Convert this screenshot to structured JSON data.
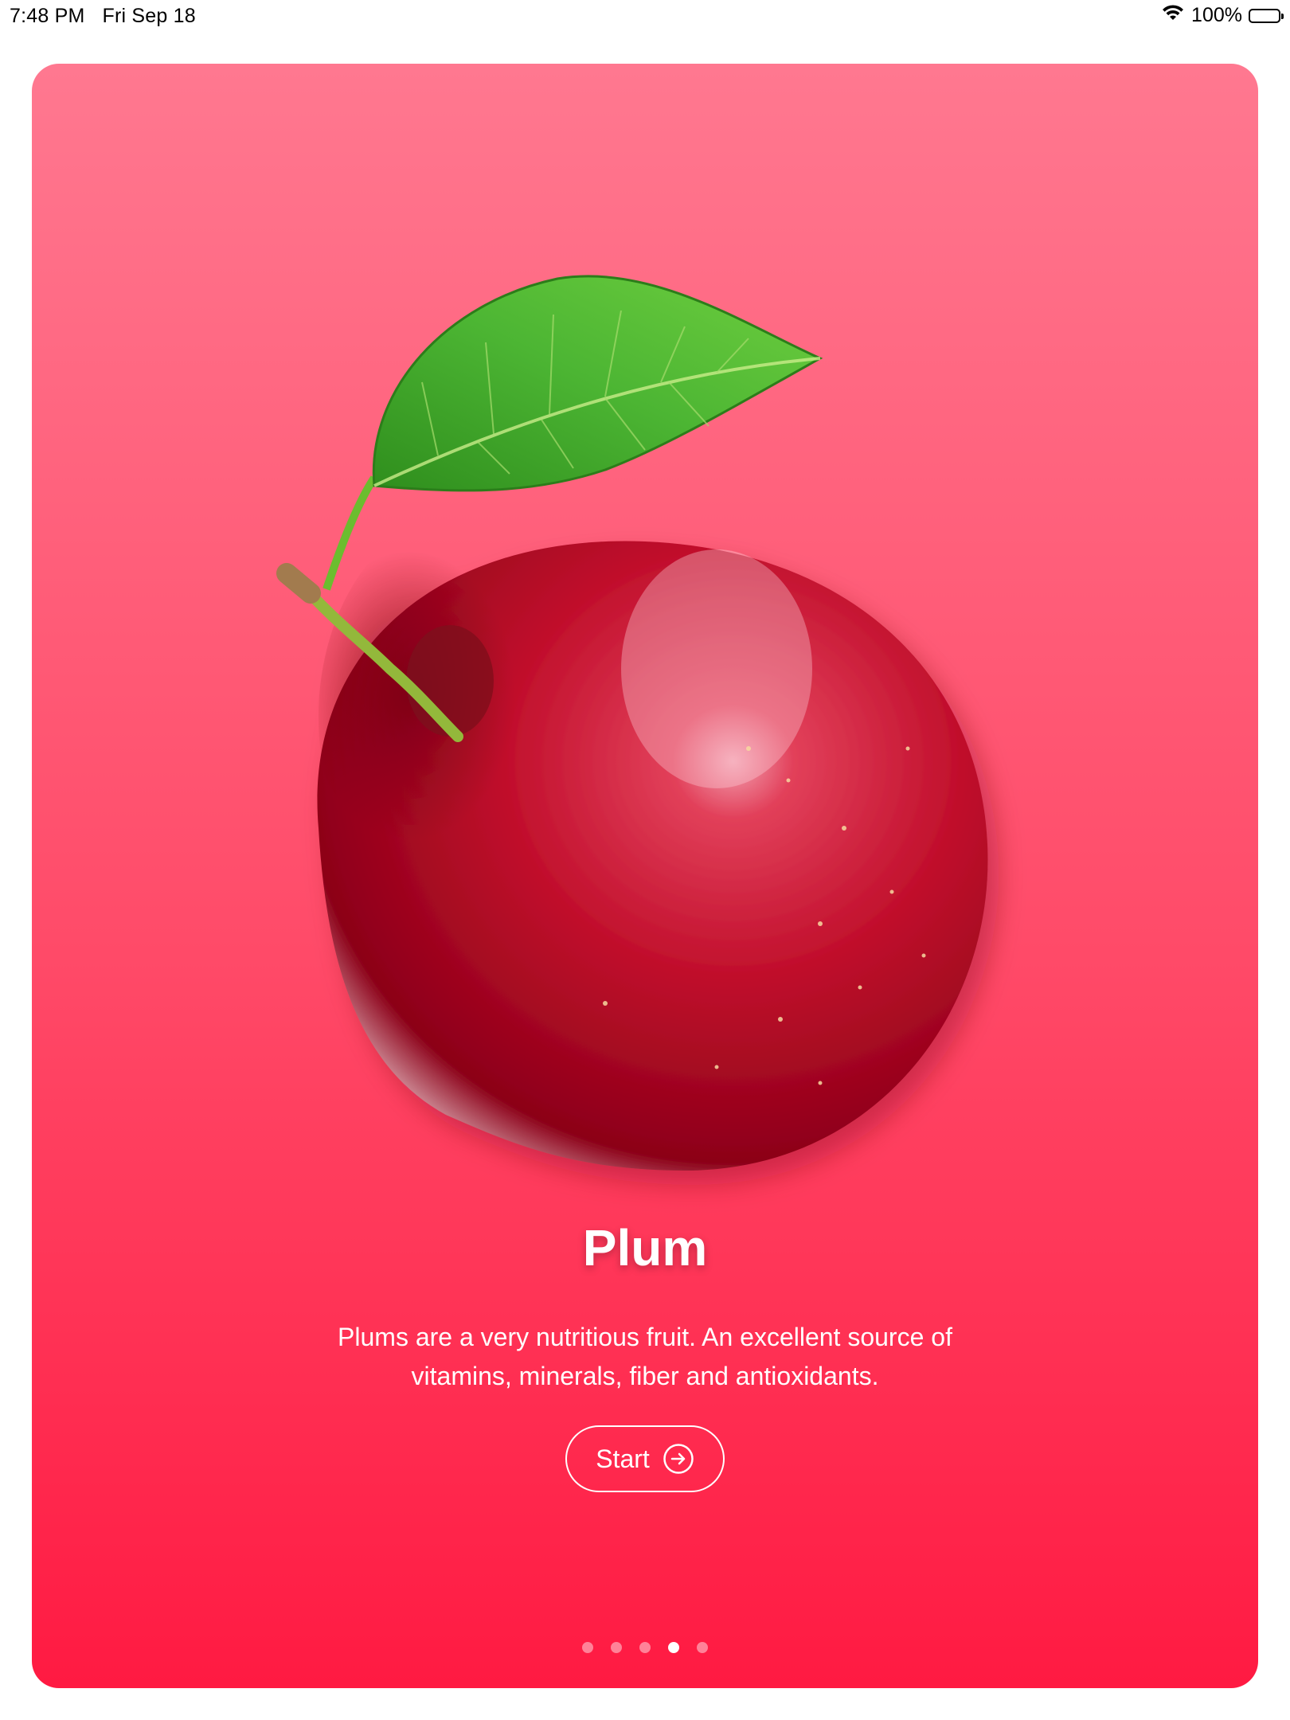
{
  "status_bar": {
    "time": "7:48 PM",
    "date": "Fri Sep 18",
    "battery_percent": "100%",
    "battery_level": 1.0
  },
  "onboarding": {
    "title": "Plum",
    "description": "Plums are a very nutritious fruit. An excellent source of vitamins, minerals, fiber and antioxidants.",
    "start_label": "Start",
    "image_subject": "plum-with-leaf",
    "page_count": 5,
    "current_page": 4
  },
  "colors": {
    "gradient_top": "#ff7890",
    "gradient_bottom": "#ff1a42",
    "plum": "#c4102e",
    "leaf": "#3fa329"
  },
  "icons": {
    "wifi": "wifi-icon",
    "battery": "battery-icon",
    "start_arrow": "arrow-right-circle-icon"
  }
}
